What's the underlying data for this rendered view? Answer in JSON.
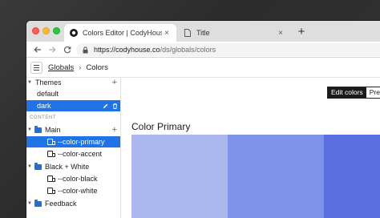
{
  "browser": {
    "tabs": [
      {
        "title": "Colors Editor | CodyHouse",
        "close": "×",
        "favicon": "codyhouse-logo-icon"
      },
      {
        "title": "Title",
        "close": "×",
        "favicon": "page-icon"
      }
    ],
    "new_tab": "+",
    "url_host": "https://codyhouse.co",
    "url_path": "/ds/globals/colors"
  },
  "header": {
    "crumb_parent": "Globals",
    "crumb_sep": "›",
    "crumb_current": "Colors"
  },
  "sidebar": {
    "themes_label": "Themes",
    "themes": [
      "default",
      "dark"
    ],
    "selected_theme": "dark",
    "content_label": "CONTENT",
    "groups": [
      {
        "label": "Main",
        "items": [
          "--color-primary",
          "--color-accent"
        ]
      },
      {
        "label": "Black + White",
        "items": [
          "--color-black",
          "--color-white"
        ]
      },
      {
        "label": "Feedback",
        "items": []
      }
    ],
    "selected_item": "--color-primary",
    "plus": "+"
  },
  "main": {
    "toggle_edit": "Edit colors",
    "toggle_preview": "Preview",
    "color_title": "Color Primary",
    "swatches": [
      "#aab7ee",
      "#7d92e8",
      "#5a6ee0"
    ]
  }
}
